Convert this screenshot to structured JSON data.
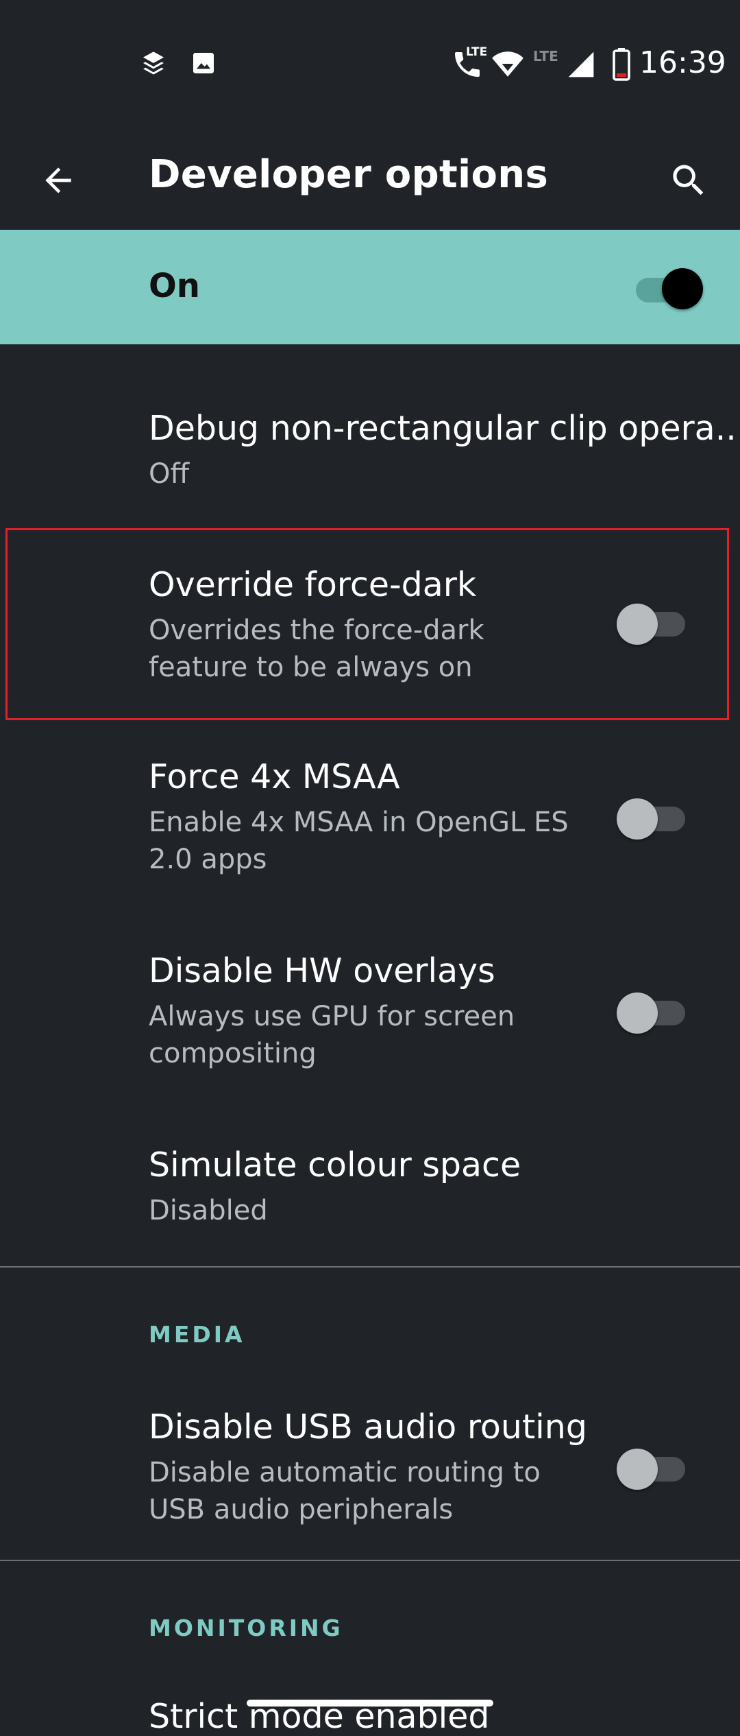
{
  "status_bar": {
    "time": "16:39",
    "left_icons": [
      "layers-icon",
      "image-icon"
    ],
    "right_icons": [
      "lte-call-icon",
      "wifi-icon",
      "lte-signal-icon",
      "signal-icon",
      "battery-icon"
    ],
    "lte_label_1": "LTE",
    "lte_label_2": "LTE"
  },
  "toolbar": {
    "back_icon": "arrow-back-icon",
    "title": "Developer options",
    "search_icon": "search-icon"
  },
  "master_switch": {
    "label": "On",
    "checked": true
  },
  "items": [
    {
      "title": "Debug non-rectangular clip opera..",
      "summary": "Off"
    },
    {
      "title": "Override force-dark",
      "summary": "Overrides the force-dark feature to be always on",
      "checked": false
    },
    {
      "title": "Force 4x MSAA",
      "summary": "Enable 4x MSAA in OpenGL ES 2.0 apps",
      "checked": false
    },
    {
      "title": "Disable HW overlays",
      "summary": "Always use GPU for screen compositing",
      "checked": false
    },
    {
      "title": "Simulate colour space",
      "summary": "Disabled"
    }
  ],
  "sections": {
    "media": {
      "header": "MEDIA",
      "items": [
        {
          "title": "Disable USB audio routing",
          "summary": "Disable automatic routing to USB audio peripherals",
          "checked": false
        }
      ]
    },
    "monitoring": {
      "header": "MONITORING",
      "items": [
        {
          "title": "Strict mode enabled"
        }
      ]
    }
  },
  "colors": {
    "background": "#202428",
    "accent": "#7fcbc4",
    "highlight_border": "#e0212b"
  }
}
